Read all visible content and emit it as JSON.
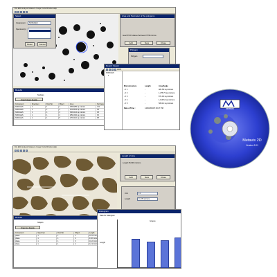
{
  "top_screenshot": {
    "app": {
      "menubar": "File   Edit   Analysis   Measure   Image   Tools   Window   Help",
      "select_tool": {
        "title": "Select",
        "component_label": "Component",
        "component_value": "NODULES",
        "specimen_label": "Specimen(s)",
        "reset_label": "Reset",
        "cancel_label": "Cancel"
      },
      "area_dialog": {
        "title": "Area and Perimeter of the polygons",
        "message": "Area MT 25 Surfaces Perimeter 175.56 microns",
        "add_label": "Add",
        "new_label": "New",
        "close_label": "Close"
      },
      "polygon_panel": {
        "title": "Polygon",
        "field_label": "Polygon"
      },
      "results": {
        "title": "Results",
        "subtitle": "Nodules",
        "show_label": "Draw Polygon Results",
        "columns": [
          "Component",
          "Specimen",
          "Field No",
          "Object",
          "Area",
          "Perimeter"
        ],
        "rows": [
          [
            "NODULES",
            "1",
            "1",
            "1",
            "325.9255 sq.microns",
            "101"
          ],
          [
            "NODULES",
            "1",
            "1",
            "2",
            "321.5678 sq.microns",
            "95"
          ],
          [
            "NODULES",
            "1",
            "1",
            "3",
            "306.2144 sq.microns",
            "98"
          ],
          [
            "NODULES",
            "1",
            "1",
            "4",
            "289.1022 sq.microns",
            "90"
          ],
          [
            "NODULES",
            "1",
            "1",
            "5",
            "276.4410 sq.microns",
            "88"
          ]
        ]
      }
    },
    "report_viewer": {
      "title": "Report Viewer",
      "toolbar_label": "100%",
      "tree_root": "NODULES",
      "tree_child": "1",
      "header": [
        "Microstructure",
        "Length",
        "Area/Angle"
      ],
      "rows": [
        [
          "- F 1",
          "-",
          "481.58 sq.microns"
        ],
        [
          "- F 2",
          "-",
          "1,278.73 sq.microns"
        ],
        [
          "- F 3",
          "-",
          "871.92 sq.microns"
        ],
        [
          "- F 4",
          "-",
          "1,119.64 sq.microns"
        ],
        [
          "- F 5",
          "-",
          "568.12 sq.microns"
        ]
      ],
      "footer_label": "Date & Time :",
      "footer_value": "14/03/2004 5:03:47 PM"
    }
  },
  "cd": {
    "label": "METAVIS",
    "product": "Metavis 2D",
    "version": "Version 2.01"
  },
  "bottom_screenshot": {
    "app": {
      "menubar": "File   Edit   Analysis   Measure   Image   Tools   Window   Help",
      "length_dialog": {
        "title": "Length of Line",
        "value": "Length 25.000 microns",
        "add_label": "Add",
        "new_label": "New",
        "close_label": "Close"
      },
      "input_dialog": {
        "unit_label": "Unit",
        "unit_value": "L1",
        "length_label": "Length",
        "length_value": "11.25 microns"
      },
      "results": {
        "title": "Results",
        "subtitle": "Grapes",
        "show_label": "Draw Line Results",
        "columns": [
          "Component",
          "Specimen",
          "Field No",
          "Object",
          "Length"
        ],
        "rows": [
          [
            "phase",
            "1",
            "1",
            "1",
            "11.51 microns"
          ],
          [
            "phase",
            "1",
            "1",
            "2",
            "9.93 microns"
          ],
          [
            "phase",
            "1",
            "1",
            "3",
            "10.24 microns"
          ],
          [
            "phase",
            "1",
            "1",
            "4",
            "12.44 microns"
          ]
        ]
      },
      "histogram": {
        "title": "Histogram",
        "subtitle": "Data for Histogram",
        "legend": "Grapes",
        "ylabel": "Length"
      }
    }
  }
}
